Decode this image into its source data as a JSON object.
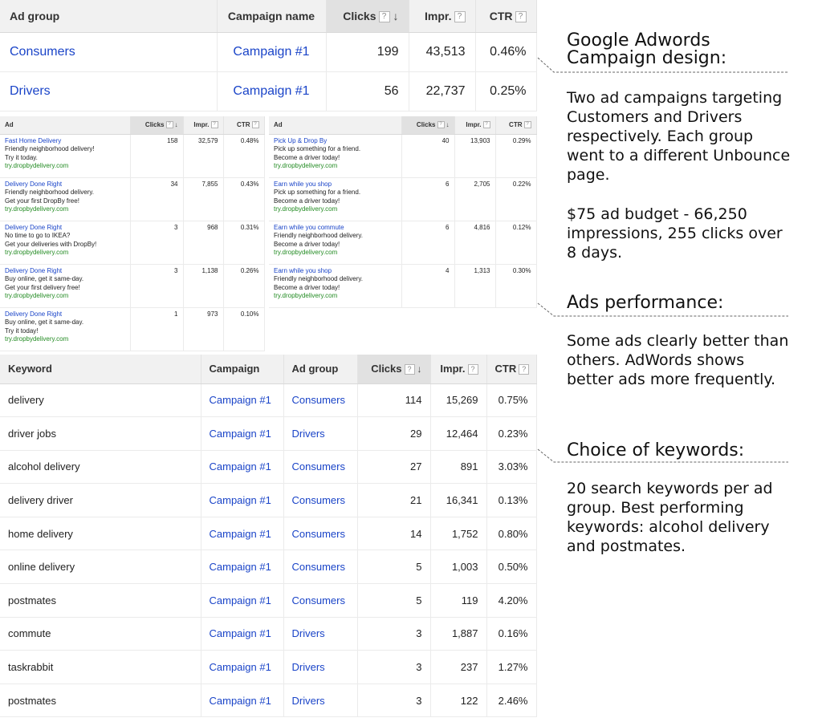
{
  "adgroup_table": {
    "headers": {
      "ad_group": "Ad group",
      "campaign_name": "Campaign name",
      "clicks": "Clicks",
      "impr": "Impr.",
      "ctr": "CTR"
    },
    "rows": [
      {
        "ad_group": "Consumers",
        "campaign": "Campaign #1",
        "clicks": "199",
        "impr": "43,513",
        "ctr": "0.46%"
      },
      {
        "ad_group": "Drivers",
        "campaign": "Campaign #1",
        "clicks": "56",
        "impr": "22,737",
        "ctr": "0.25%"
      }
    ]
  },
  "ads_left": {
    "headers": {
      "ad": "Ad",
      "clicks": "Clicks",
      "impr": "Impr.",
      "ctr": "CTR"
    },
    "rows": [
      {
        "headline": "Fast Home Delivery",
        "line1": "Friendly neighborhood delivery!",
        "line2": "Try it today.",
        "url": "try.dropbydelivery.com",
        "clicks": "158",
        "impr": "32,579",
        "ctr": "0.48%"
      },
      {
        "headline": "Delivery Done Right",
        "line1": "Friendly neighborhood delivery.",
        "line2": "Get your first DropBy free!",
        "url": "try.dropbydelivery.com",
        "clicks": "34",
        "impr": "7,855",
        "ctr": "0.43%"
      },
      {
        "headline": "Delivery Done Right",
        "line1": "No time to go to IKEA?",
        "line2": "Get your deliveries with DropBy!",
        "url": "try.dropbydelivery.com",
        "clicks": "3",
        "impr": "968",
        "ctr": "0.31%"
      },
      {
        "headline": "Delivery Done Right",
        "line1": "Buy online, get it same-day.",
        "line2": "Get your first delivery free!",
        "url": "try.dropbydelivery.com",
        "clicks": "3",
        "impr": "1,138",
        "ctr": "0.26%"
      },
      {
        "headline": "Delivery Done Right",
        "line1": "Buy online, get it same-day.",
        "line2": "Try it today!",
        "url": "try.dropbydelivery.com",
        "clicks": "1",
        "impr": "973",
        "ctr": "0.10%"
      }
    ]
  },
  "ads_right": {
    "headers": {
      "ad": "Ad",
      "clicks": "Clicks",
      "impr": "Impr.",
      "ctr": "CTR"
    },
    "rows": [
      {
        "headline": "Pick Up & Drop By",
        "line1": "Pick up something for a friend.",
        "line2": "Become a driver today!",
        "url": "try.dropbydelivery.com",
        "clicks": "40",
        "impr": "13,903",
        "ctr": "0.29%"
      },
      {
        "headline": "Earn while you shop",
        "line1": "Pick up something for a friend.",
        "line2": "Become a driver today!",
        "url": "try.dropbydelivery.com",
        "clicks": "6",
        "impr": "2,705",
        "ctr": "0.22%"
      },
      {
        "headline": "Earn while you commute",
        "line1": "Friendly neighborhood delivery.",
        "line2": "Become a driver today!",
        "url": "try.dropbydelivery.com",
        "clicks": "6",
        "impr": "4,816",
        "ctr": "0.12%"
      },
      {
        "headline": "Earn while you shop",
        "line1": "Friendly neighborhood delivery.",
        "line2": "Become a driver today!",
        "url": "try.dropbydelivery.com",
        "clicks": "4",
        "impr": "1,313",
        "ctr": "0.30%"
      }
    ]
  },
  "keyword_table": {
    "headers": {
      "keyword": "Keyword",
      "campaign": "Campaign",
      "ad_group": "Ad group",
      "clicks": "Clicks",
      "impr": "Impr.",
      "ctr": "CTR"
    },
    "rows": [
      {
        "keyword": "delivery",
        "campaign": "Campaign #1",
        "ad_group": "Consumers",
        "clicks": "114",
        "impr": "15,269",
        "ctr": "0.75%"
      },
      {
        "keyword": "driver jobs",
        "campaign": "Campaign #1",
        "ad_group": "Drivers",
        "clicks": "29",
        "impr": "12,464",
        "ctr": "0.23%"
      },
      {
        "keyword": "alcohol delivery",
        "campaign": "Campaign #1",
        "ad_group": "Consumers",
        "clicks": "27",
        "impr": "891",
        "ctr": "3.03%"
      },
      {
        "keyword": "delivery driver",
        "campaign": "Campaign #1",
        "ad_group": "Consumers",
        "clicks": "21",
        "impr": "16,341",
        "ctr": "0.13%"
      },
      {
        "keyword": "home delivery",
        "campaign": "Campaign #1",
        "ad_group": "Consumers",
        "clicks": "14",
        "impr": "1,752",
        "ctr": "0.80%"
      },
      {
        "keyword": "online delivery",
        "campaign": "Campaign #1",
        "ad_group": "Consumers",
        "clicks": "5",
        "impr": "1,003",
        "ctr": "0.50%"
      },
      {
        "keyword": "postmates",
        "campaign": "Campaign #1",
        "ad_group": "Consumers",
        "clicks": "5",
        "impr": "119",
        "ctr": "4.20%"
      },
      {
        "keyword": "commute",
        "campaign": "Campaign #1",
        "ad_group": "Drivers",
        "clicks": "3",
        "impr": "1,887",
        "ctr": "0.16%"
      },
      {
        "keyword": "taskrabbit",
        "campaign": "Campaign #1",
        "ad_group": "Drivers",
        "clicks": "3",
        "impr": "237",
        "ctr": "1.27%"
      },
      {
        "keyword": "postmates",
        "campaign": "Campaign #1",
        "ad_group": "Drivers",
        "clicks": "3",
        "impr": "122",
        "ctr": "2.46%"
      }
    ]
  },
  "ui": {
    "help_glyph": "?",
    "sort_arrow": "↓"
  },
  "notes": {
    "campaign_design": {
      "title_line1": "Google Adwords",
      "title_line2": "Campaign design:",
      "body1": "Two ad campaigns targeting Customers and Drivers respectively. Each group went to a different Unbounce page.",
      "body2": "$75 ad budget - 66,250 impressions, 255 clicks over 8 days."
    },
    "ads_performance": {
      "title": "Ads performance:",
      "body": "Some ads clearly better than others.  AdWords shows better ads more frequently."
    },
    "keywords": {
      "title": "Choice of keywords:",
      "body": "20 search keywords per ad group. Best performing keywords: alcohol delivery and postmates."
    }
  },
  "colors": {
    "link": "#1a44c8",
    "url_green": "#228b22",
    "header_bg": "#f1f1f1",
    "sorted_header_bg": "#e1e1e1"
  }
}
